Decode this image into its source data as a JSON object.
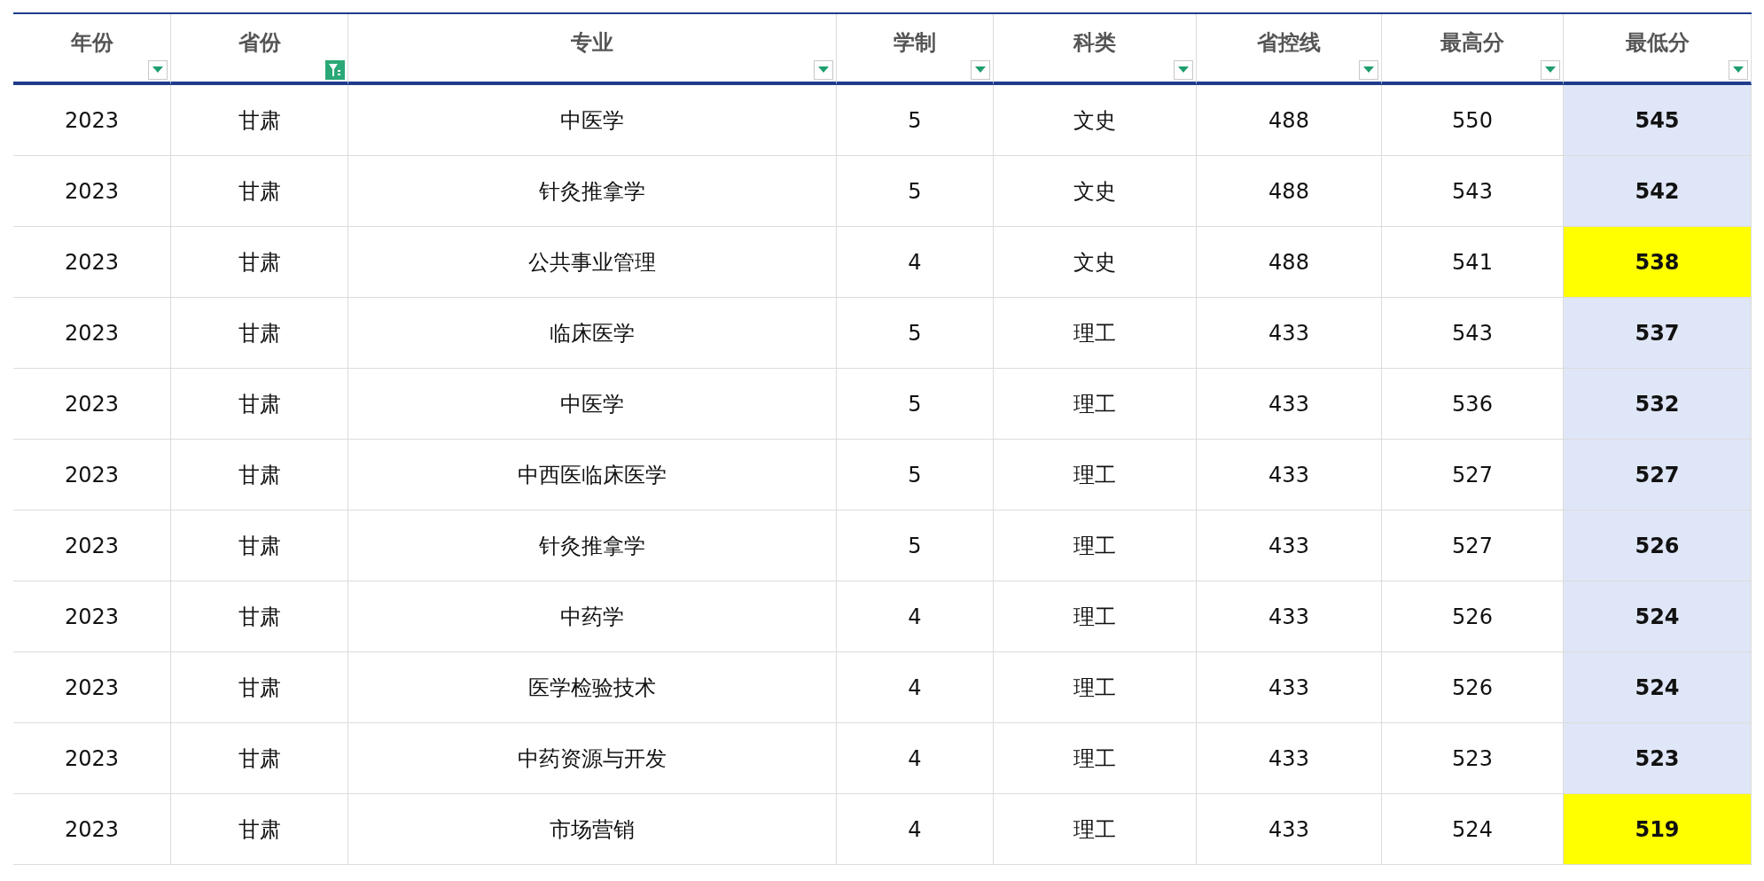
{
  "table": {
    "columns": [
      {
        "label": "年份",
        "filtered": false
      },
      {
        "label": "省份",
        "filtered": true
      },
      {
        "label": "专业",
        "filtered": false
      },
      {
        "label": "学制",
        "filtered": false
      },
      {
        "label": "科类",
        "filtered": false
      },
      {
        "label": "省控线",
        "filtered": false
      },
      {
        "label": "最高分",
        "filtered": false
      },
      {
        "label": "最低分",
        "filtered": false
      }
    ],
    "rows": [
      {
        "cells": [
          "2023",
          "甘肃",
          "中医学",
          "5",
          "文史",
          "488",
          "550",
          "545"
        ],
        "color": "#dfe6f7"
      },
      {
        "cells": [
          "2023",
          "甘肃",
          "针灸推拿学",
          "5",
          "文史",
          "488",
          "543",
          "542"
        ],
        "color": "#dfe6f7"
      },
      {
        "cells": [
          "2023",
          "甘肃",
          "公共事业管理",
          "4",
          "文史",
          "488",
          "541",
          "538"
        ],
        "color": "#ffff00"
      },
      {
        "cells": [
          "2023",
          "甘肃",
          "临床医学",
          "5",
          "理工",
          "433",
          "543",
          "537"
        ],
        "color": "#dfe6f7"
      },
      {
        "cells": [
          "2023",
          "甘肃",
          "中医学",
          "5",
          "理工",
          "433",
          "536",
          "532"
        ],
        "color": "#dfe6f7"
      },
      {
        "cells": [
          "2023",
          "甘肃",
          "中西医临床医学",
          "5",
          "理工",
          "433",
          "527",
          "527"
        ],
        "color": "#dfe6f7"
      },
      {
        "cells": [
          "2023",
          "甘肃",
          "针灸推拿学",
          "5",
          "理工",
          "433",
          "527",
          "526"
        ],
        "color": "#dfe6f7"
      },
      {
        "cells": [
          "2023",
          "甘肃",
          "中药学",
          "4",
          "理工",
          "433",
          "526",
          "524"
        ],
        "color": "#dfe6f7"
      },
      {
        "cells": [
          "2023",
          "甘肃",
          "医学检验技术",
          "4",
          "理工",
          "433",
          "526",
          "524"
        ],
        "color": "#dfe6f7"
      },
      {
        "cells": [
          "2023",
          "甘肃",
          "中药资源与开发",
          "4",
          "理工",
          "433",
          "523",
          "523"
        ],
        "color": "#dfe6f7"
      },
      {
        "cells": [
          "2023",
          "甘肃",
          "市场营销",
          "4",
          "理工",
          "433",
          "524",
          "519"
        ],
        "color": "#ffff00"
      }
    ]
  }
}
